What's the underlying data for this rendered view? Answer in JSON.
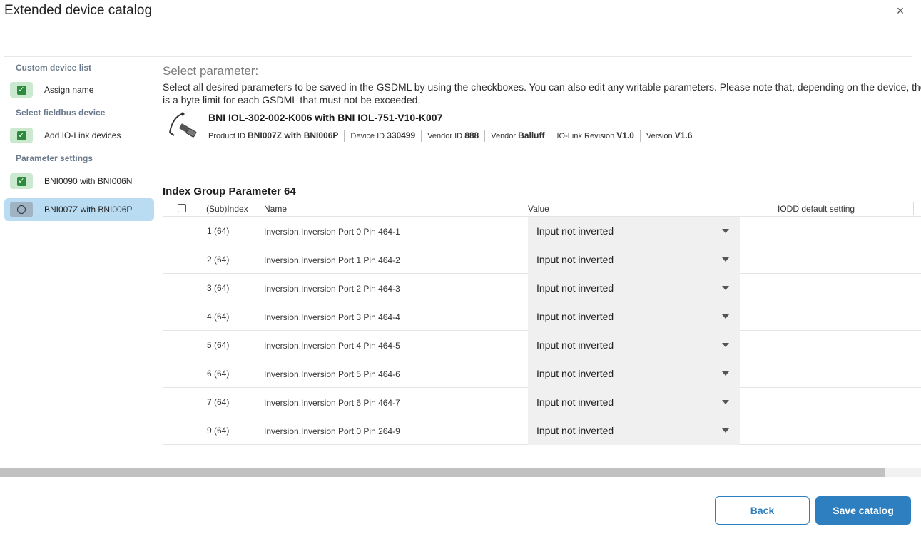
{
  "dialog": {
    "title": "Extended device catalog",
    "close_glyph": "×"
  },
  "sidebar": {
    "sections": [
      {
        "heading": "Custom device list",
        "steps": [
          {
            "label": "Assign name",
            "state": "done"
          }
        ]
      },
      {
        "heading": "Select fieldbus device",
        "steps": [
          {
            "label": "Add IO-Link devices",
            "state": "done"
          }
        ]
      },
      {
        "heading": "Parameter settings",
        "steps": [
          {
            "label": "BNI0090 with BNI006N",
            "state": "done"
          },
          {
            "label": "BNI007Z with BNI006P",
            "state": "current"
          }
        ]
      }
    ],
    "check_glyph": "✓"
  },
  "main": {
    "title": "Select parameter:",
    "description_line1": "Select all desired parameters to be saved in the GSDML by using the checkboxes. You can also edit any writable parameters. Please note that, depending on the device, there",
    "description_line2": "is a byte limit for each GSDML that must not be exceeded.",
    "device": {
      "name": "BNI IOL-302-002-K006 with BNI IOL-751-V10-K007",
      "meta": [
        {
          "label": "Product ID",
          "value": "BNI007Z with BNI006P"
        },
        {
          "label": "Device ID",
          "value": "330499"
        },
        {
          "label": "Vendor ID",
          "value": "888"
        },
        {
          "label": "Vendor",
          "value": "Balluff"
        },
        {
          "label": "IO-Link Revision",
          "value": "V1.0"
        },
        {
          "label": "Version",
          "value": "V1.6"
        }
      ]
    },
    "group_title": "Index Group Parameter 64",
    "table": {
      "columns": [
        "(Sub)Index",
        "Name",
        "Value",
        "IODD default setting"
      ],
      "rows": [
        {
          "index": "1 (64)",
          "name": "Inversion.Inversion Port 0 Pin 464-1",
          "value": "Input not inverted"
        },
        {
          "index": "2 (64)",
          "name": "Inversion.Inversion Port 1 Pin 464-2",
          "value": "Input not inverted"
        },
        {
          "index": "3 (64)",
          "name": "Inversion.Inversion Port 2 Pin 464-3",
          "value": "Input not inverted"
        },
        {
          "index": "4 (64)",
          "name": "Inversion.Inversion Port 3 Pin 464-4",
          "value": "Input not inverted"
        },
        {
          "index": "5 (64)",
          "name": "Inversion.Inversion Port 4 Pin 464-5",
          "value": "Input not inverted"
        },
        {
          "index": "6 (64)",
          "name": "Inversion.Inversion Port 5 Pin 464-6",
          "value": "Input not inverted"
        },
        {
          "index": "7 (64)",
          "name": "Inversion.Inversion Port 6 Pin 464-7",
          "value": "Input not inverted"
        },
        {
          "index": "9 (64)",
          "name": "Inversion.Inversion Port 0 Pin 264-9",
          "value": "Input not inverted"
        }
      ]
    }
  },
  "footer": {
    "back_label": "Back",
    "save_label": "Save catalog"
  },
  "colors": {
    "accent": "#2e7fbf",
    "active_step_bg": "#b9dcf2",
    "done_step_bg": "#cbe9cf",
    "check_green": "#2e8b3e"
  },
  "icons": {
    "close": "close-icon",
    "check": "checkmark-icon",
    "device": "device-cable-icon",
    "dropdown": "chevron-down-icon"
  }
}
